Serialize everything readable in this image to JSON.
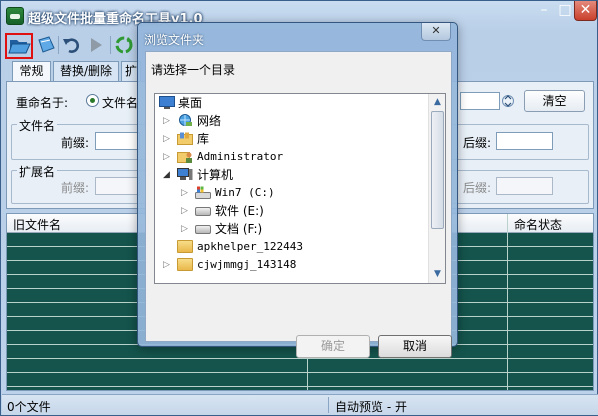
{
  "window": {
    "title": "超级文件批量重命名工具v1.0"
  },
  "titlebar": {
    "minimize": "–",
    "maximize": "□",
    "close": "✕"
  },
  "tabs": [
    {
      "label": "常规"
    },
    {
      "label": "替换/删除"
    },
    {
      "label": "扩"
    }
  ],
  "rename": {
    "label": "重命名于:",
    "option": "文件名",
    "clear_button": "清空"
  },
  "filename_group": {
    "title": "文件名",
    "prefix_label": "前缀:",
    "suffix_label": "后缀:"
  },
  "ext_group": {
    "title": "扩展名",
    "prefix_label": "前缀:",
    "suffix_label": "后缀:"
  },
  "grid": {
    "columns": [
      "旧文件名",
      "命名状态"
    ]
  },
  "status": {
    "count": "0个文件",
    "preview": "自动预览 - 开"
  },
  "dialog": {
    "title": "浏览文件夹",
    "close": "✕",
    "prompt": "请选择一个目录",
    "tree": [
      {
        "label": "桌面",
        "icon": "desktop-icon",
        "expander": ""
      },
      {
        "label": "网络",
        "icon": "network-icon",
        "expander": "▷"
      },
      {
        "label": "库",
        "icon": "library-icon",
        "expander": "▷"
      },
      {
        "label": "Administrator",
        "icon": "user-folder-icon",
        "expander": "▷"
      },
      {
        "label": "计算机",
        "icon": "computer-icon",
        "expander": "◢"
      },
      {
        "label": "Win7 (C:)",
        "icon": "system-drive-icon",
        "expander": "▷"
      },
      {
        "label": "软件 (E:)",
        "icon": "drive-icon",
        "expander": "▷"
      },
      {
        "label": "文档 (F:)",
        "icon": "drive-icon",
        "expander": "▷"
      },
      {
        "label": "apkhelper_122443",
        "icon": "folder-icon",
        "expander": ""
      },
      {
        "label": "cjwjmmgj_143148",
        "icon": "folder-icon",
        "expander": "▷"
      }
    ],
    "ok_button": "确定",
    "cancel_button": "取消"
  }
}
